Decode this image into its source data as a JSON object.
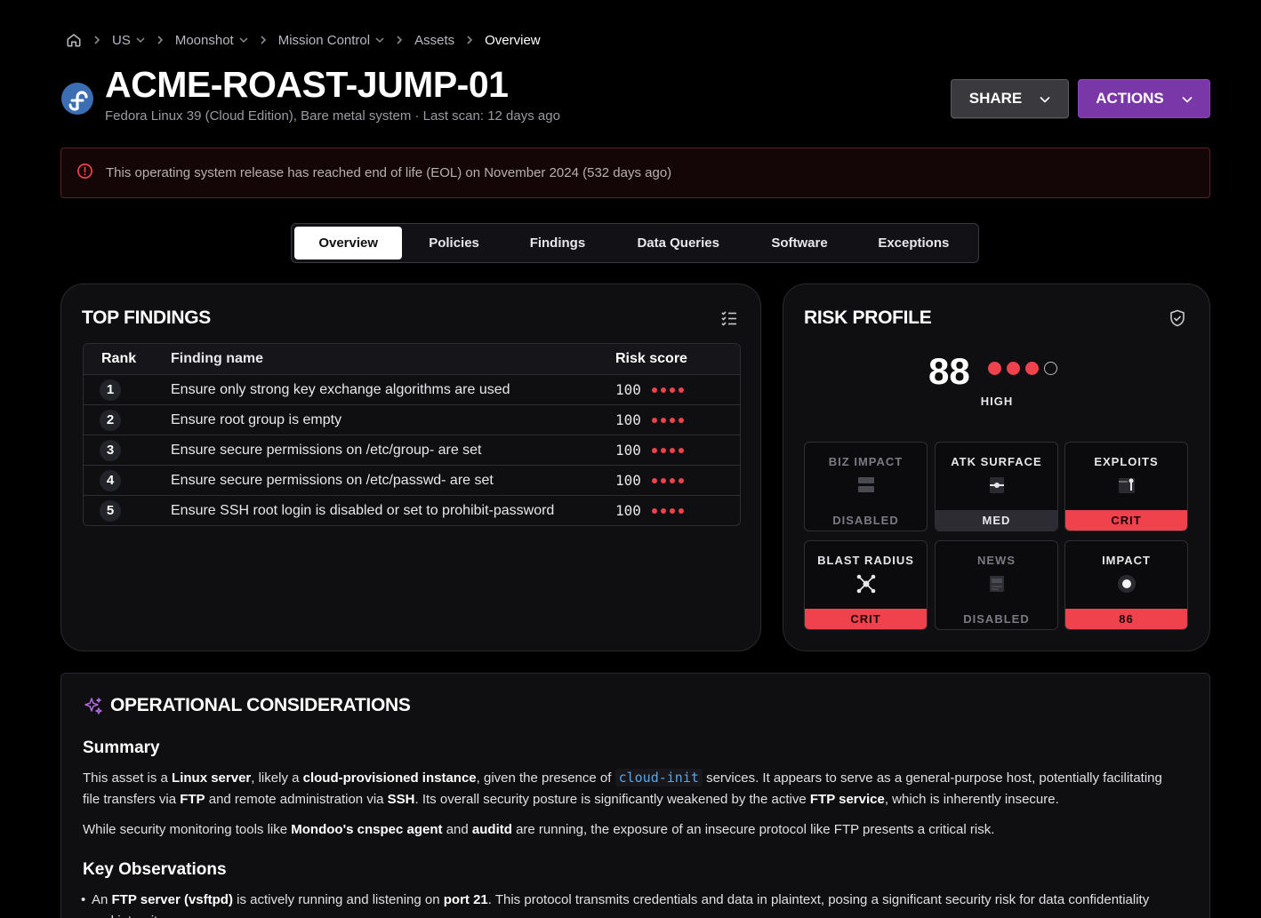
{
  "breadcrumb": {
    "items": [
      {
        "label": "US",
        "dropdown": true
      },
      {
        "label": "Moonshot",
        "dropdown": true
      },
      {
        "label": "Mission Control",
        "dropdown": true
      },
      {
        "label": "Assets",
        "dropdown": false
      },
      {
        "label": "Overview",
        "dropdown": false
      }
    ]
  },
  "asset": {
    "title": "ACME-ROAST-JUMP-01",
    "subtitle": "Fedora Linux 39 (Cloud Edition), Bare metal system · Last scan: 12 days ago",
    "logo_icon": "fedora-logo"
  },
  "header_buttons": {
    "share": "SHARE",
    "actions": "ACTIONS"
  },
  "eol_banner": {
    "text": "This operating system release has reached end of life (EOL) on November 2024 (532 days ago)"
  },
  "tabs": [
    {
      "label": "Overview",
      "active": true
    },
    {
      "label": "Policies",
      "active": false
    },
    {
      "label": "Findings",
      "active": false
    },
    {
      "label": "Data Queries",
      "active": false
    },
    {
      "label": "Software",
      "active": false
    },
    {
      "label": "Exceptions",
      "active": false
    }
  ],
  "top_findings": {
    "title": "TOP FINDINGS",
    "columns": [
      "Rank",
      "Finding name",
      "Risk score"
    ],
    "rows": [
      {
        "rank": "1",
        "name": "Ensure only strong key exchange algorithms are used",
        "score": "100",
        "dots": 4
      },
      {
        "rank": "2",
        "name": "Ensure root group is empty",
        "score": "100",
        "dots": 4
      },
      {
        "rank": "3",
        "name": "Ensure secure permissions on /etc/group- are set",
        "score": "100",
        "dots": 4
      },
      {
        "rank": "4",
        "name": "Ensure secure permissions on /etc/passwd- are set",
        "score": "100",
        "dots": 4
      },
      {
        "rank": "5",
        "name": "Ensure SSH root login is disabled or set to prohibit-password",
        "score": "100",
        "dots": 4
      }
    ]
  },
  "risk_profile": {
    "title": "RISK PROFILE",
    "score": "88",
    "filled_dots": 3,
    "total_dots": 4,
    "level": "HIGH",
    "tiles": [
      {
        "label": "BIZ IMPACT",
        "value": "DISABLED",
        "state": "disabled",
        "icon": "server-icon"
      },
      {
        "label": "ATK SURFACE",
        "value": "MED",
        "state": "med",
        "icon": "slider-icon"
      },
      {
        "label": "EXPLOITS",
        "value": "CRIT",
        "state": "crit",
        "icon": "exploit-icon"
      },
      {
        "label": "BLAST RADIUS",
        "value": "CRIT",
        "state": "crit",
        "icon": "blast-radius-icon"
      },
      {
        "label": "NEWS",
        "value": "DISABLED",
        "state": "disabled",
        "icon": "news-icon"
      },
      {
        "label": "IMPACT",
        "value": "86",
        "state": "crit",
        "icon": "impact-icon"
      }
    ]
  },
  "operational": {
    "title": "OPERATIONAL CONSIDERATIONS",
    "summary_heading": "Summary",
    "summary_p1": {
      "t1": "This asset is a ",
      "b1": "Linux server",
      "t2": ", likely a ",
      "b2": "cloud-provisioned instance",
      "t3": ", given the presence of ",
      "code": "cloud-init",
      "t4": " services. It appears to serve as a general-purpose host, potentially facilitating file transfers via ",
      "b3": "FTP",
      "t5": " and remote administration via ",
      "b4": "SSH",
      "t6": ". Its overall security posture is significantly weakened by the active ",
      "b5": "FTP service",
      "t7": ", which is inherently insecure."
    },
    "summary_p2": {
      "t1": "While security monitoring tools like ",
      "b1": "Mondoo's cnspec agent",
      "t2": " and ",
      "b2": "auditd",
      "t3": " are running, the exposure of an insecure protocol like FTP presents a critical risk."
    },
    "key_heading": "Key Observations",
    "obs1": {
      "t1": "An ",
      "b1": "FTP server (vsftpd)",
      "t2": " is actively running and listening on ",
      "b2": "port 21",
      "t3": ". This protocol transmits credentials and data in plaintext, posing a significant security risk for data confidentiality and integrity."
    }
  },
  "colors": {
    "accent_purple": "#7a37a8",
    "critical_red": "#f0424d"
  }
}
